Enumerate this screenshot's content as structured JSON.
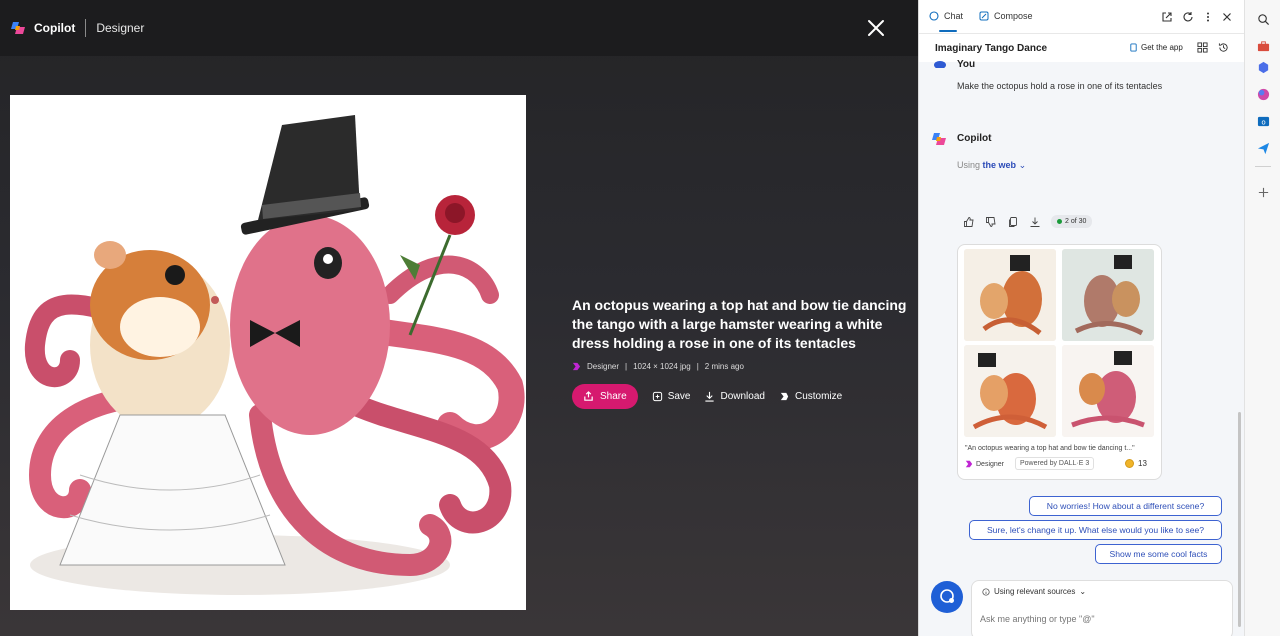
{
  "viewer": {
    "brand": "Copilot",
    "product": "Designer",
    "caption": "An octopus wearing a top hat and bow tie dancing the tango with a large hamster wearing a white dress holding a rose in one of its tentacles",
    "meta": {
      "source": "Designer",
      "sep": "|",
      "dimensions": "1024 × 1024 jpg",
      "age": "2 mins ago"
    },
    "actions": {
      "share": "Share",
      "save": "Save",
      "download": "Download",
      "customize": "Customize"
    },
    "icons": [
      "close-icon",
      "chevron-left-icon",
      "share-icon",
      "save-icon",
      "download-icon",
      "customize-icon"
    ]
  },
  "panel": {
    "tabs": {
      "chat": "Chat",
      "compose": "Compose"
    },
    "conversation_title": "Imaginary Tango Dance",
    "get_app": "Get the app",
    "user": {
      "name": "You",
      "message": "Make the octopus hold a rose in one of its tentacles"
    },
    "copilot": {
      "name": "Copilot",
      "using_prefix": "Using",
      "using_link": "the web",
      "response_count": "2 of 30"
    },
    "image_card": {
      "caption": "\"An octopus wearing a top hat and bow tie dancing t...\"",
      "creator": "Designer",
      "powered_by": "Powered by DALL·E 3",
      "boosts": "13"
    },
    "suggestions": [
      "No worries! How about a different scene?",
      "Sure, let's change it up. What else would you like to see?",
      "Show me some cool facts"
    ],
    "compose": {
      "sources_label": "Using relevant sources",
      "placeholder": "Ask me anything or type \"@\""
    }
  },
  "colors": {
    "share_button": "#d6196f",
    "link": "#2b4bb8",
    "new_topic": "#1f5fd6",
    "suggestion_border": "#3d63d1"
  }
}
